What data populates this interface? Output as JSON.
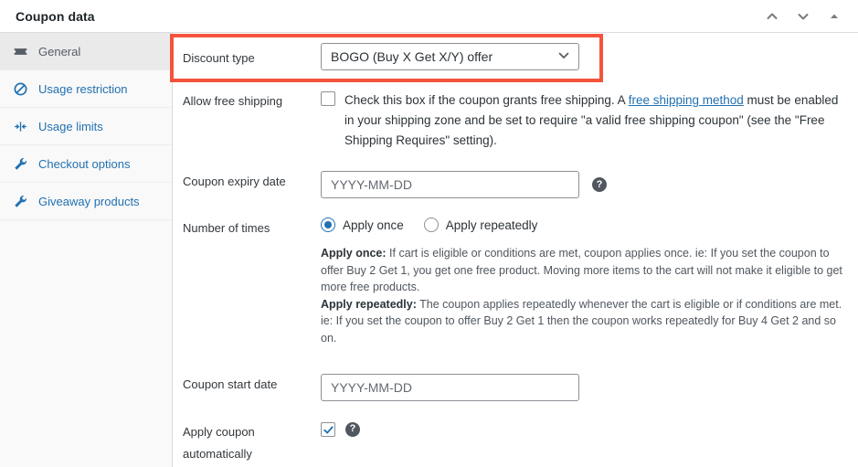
{
  "header": {
    "title": "Coupon data",
    "actions": [
      {
        "name": "move-up-icon",
        "label": "Move up"
      },
      {
        "name": "move-down-icon",
        "label": "Move down"
      },
      {
        "name": "toggle-panel-icon",
        "label": "Toggle panel"
      }
    ]
  },
  "sidebar": {
    "items": [
      {
        "label": "General",
        "icon": "ticket-icon",
        "active": true
      },
      {
        "label": "Usage restriction",
        "icon": "ban-icon",
        "active": false
      },
      {
        "label": "Usage limits",
        "icon": "limits-icon",
        "active": false
      },
      {
        "label": "Checkout options",
        "icon": "wrench-icon",
        "active": false
      },
      {
        "label": "Giveaway products",
        "icon": "wrench-icon",
        "active": false
      }
    ]
  },
  "fields": {
    "discount_type": {
      "label": "Discount type",
      "value": "BOGO (Buy X Get X/Y) offer",
      "highlighted": true,
      "highlight_color": "#f4543c"
    },
    "allow_free_shipping": {
      "label": "Allow free shipping",
      "checked": false,
      "text_before_link": "Check this box if the coupon grants free shipping. A ",
      "link_text": "free shipping method",
      "text_after_link": " must be enabled in your shipping zone and be set to require \"a valid free shipping coupon\" (see the \"Free Shipping Requires\" setting)."
    },
    "coupon_expiry_date": {
      "label": "Coupon expiry date",
      "placeholder": "YYYY-MM-DD",
      "value": "",
      "help": "?"
    },
    "number_of_times": {
      "label": "Number of times",
      "options": [
        {
          "label": "Apply once",
          "selected": true
        },
        {
          "label": "Apply repeatedly",
          "selected": false
        }
      ],
      "explanations": [
        {
          "title": "Apply once:",
          "body": " If cart is eligible or conditions are met, coupon applies once. ie: If you set the coupon to offer Buy 2 Get 1, you get one free product. Moving more items to the cart will not make it eligible to get more free products."
        },
        {
          "title": "Apply repeatedly:",
          "body": " The coupon applies repeatedly whenever the cart is eligible or if conditions are met. ie: If you set the coupon to offer Buy 2 Get 1 then the coupon works repeatedly for Buy 4 Get 2 and so on."
        }
      ]
    },
    "coupon_start_date": {
      "label": "Coupon start date",
      "placeholder": "YYYY-MM-DD",
      "value": ""
    },
    "apply_coupon_automatically": {
      "label": "Apply coupon automatically",
      "checked": true,
      "help": "?"
    }
  }
}
